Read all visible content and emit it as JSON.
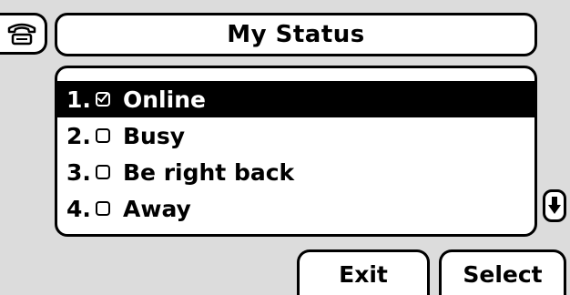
{
  "header": {
    "title": "My Status",
    "line_icon": "handset-icon"
  },
  "status_list": {
    "items": [
      {
        "number": "1.",
        "label": "Online",
        "checked": true,
        "selected": true
      },
      {
        "number": "2.",
        "label": "Busy",
        "checked": false,
        "selected": false
      },
      {
        "number": "3.",
        "label": "Be right back",
        "checked": false,
        "selected": false
      },
      {
        "number": "4.",
        "label": "Away",
        "checked": false,
        "selected": false
      }
    ],
    "scroll_icon": "scroll-down-arrow-icon"
  },
  "softkeys": {
    "exit_label": "Exit",
    "select_label": "Select"
  },
  "colors": {
    "background": "#dcdcdc",
    "panel": "#ffffff",
    "ink": "#000000",
    "highlight": "#000000"
  }
}
